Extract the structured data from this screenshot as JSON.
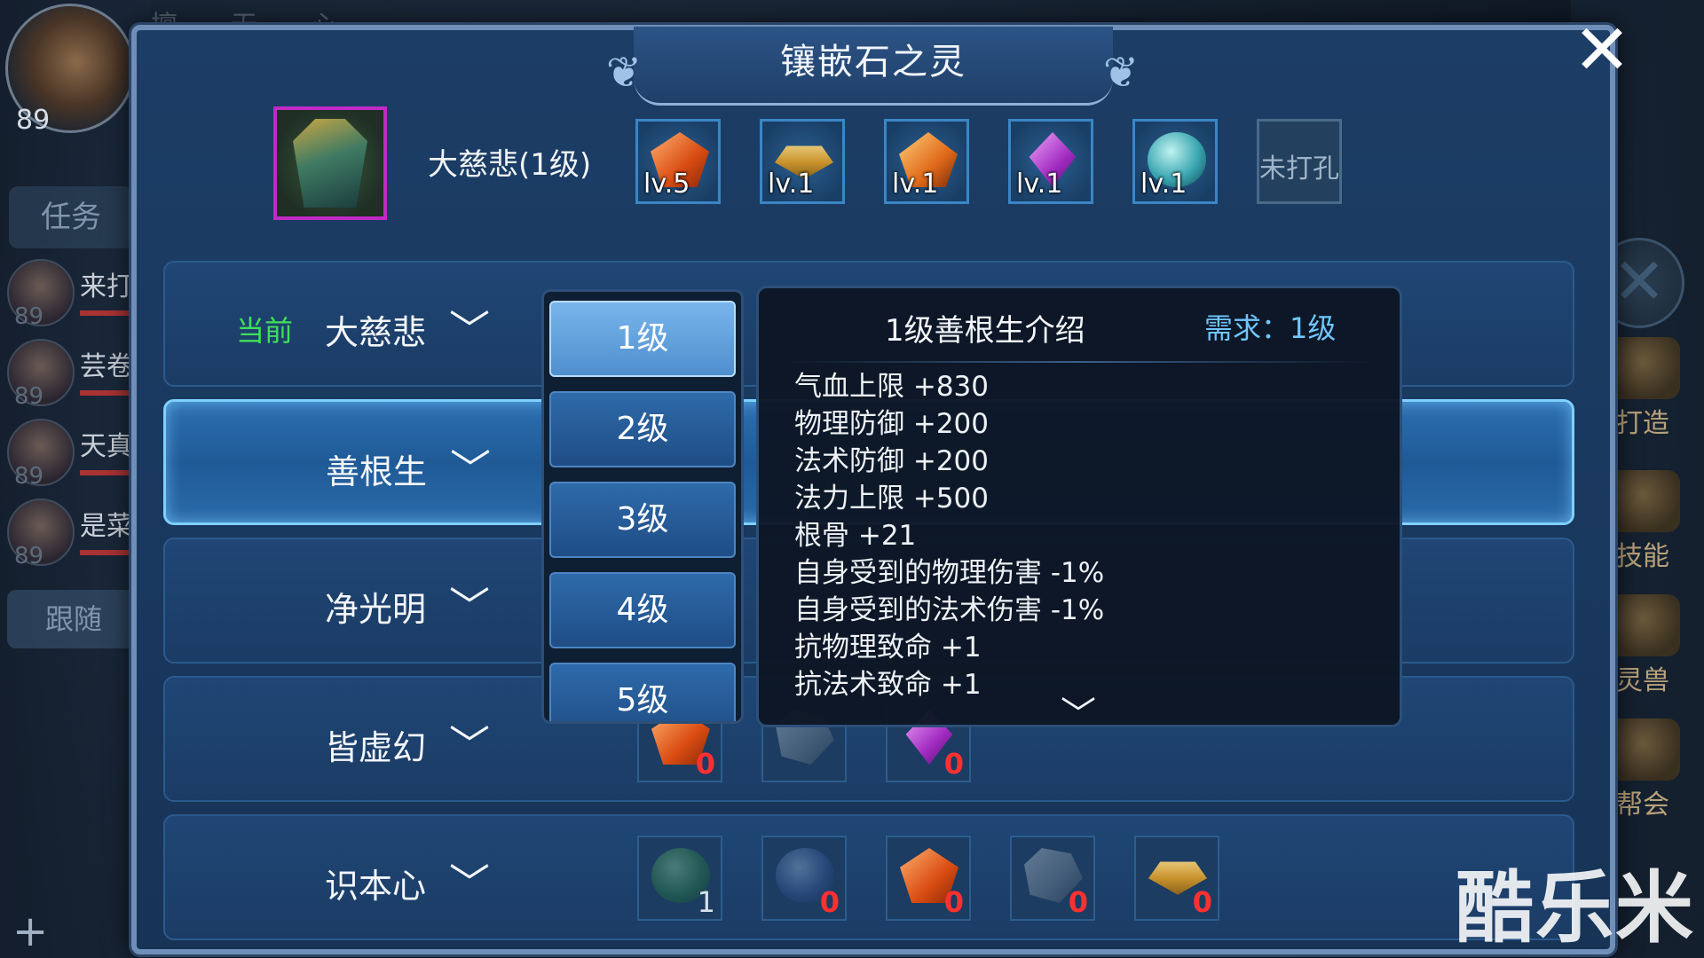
{
  "hud": {
    "top_faded_text": "擅……无……心",
    "player_level": "89",
    "task_label": "任务",
    "follow_label": "跟随",
    "team": [
      {
        "name": "来打",
        "level": "89"
      },
      {
        "name": "芸卷",
        "level": "89"
      },
      {
        "name": "天真",
        "level": "89"
      },
      {
        "name": "是菜",
        "level": "89"
      }
    ],
    "side_menu": [
      "打造",
      "技能",
      "灵兽",
      "帮会"
    ],
    "watermark": "酷乐米"
  },
  "modal": {
    "title": "镶嵌石之灵",
    "equipment": {
      "name": "大慈悲(1级)",
      "slots": [
        {
          "level": "lv.5",
          "stone": "s-orange"
        },
        {
          "level": "lv.1",
          "stone": "s-gold"
        },
        {
          "level": "lv.1",
          "stone": "s-amber"
        },
        {
          "level": "lv.1",
          "stone": "s-purple"
        },
        {
          "level": "lv.1",
          "stone": "s-teal"
        }
      ],
      "empty_slot": "未打孔"
    },
    "sets": [
      {
        "name": "大慈悲",
        "current_tag": "当前"
      },
      {
        "name": "善根生"
      },
      {
        "name": "净光明"
      },
      {
        "name": "皆虚幻"
      },
      {
        "name": "识本心"
      }
    ],
    "set_row4_gems": [
      {
        "count": "0",
        "stone": "s-orange"
      },
      {
        "count": "",
        "stone": "s-grey"
      },
      {
        "count": "0",
        "stone": "s-purple"
      }
    ],
    "set_row5_gems": [
      {
        "count": "1",
        "stone": "s-green"
      },
      {
        "count": "0",
        "stone": "s-blue"
      },
      {
        "count": "0",
        "stone": "s-orange"
      },
      {
        "count": "0",
        "stone": "s-grey"
      },
      {
        "count": "0",
        "stone": "s-gold"
      }
    ],
    "level_dropdown": [
      "1级",
      "2级",
      "3级",
      "4级",
      "5级"
    ],
    "tooltip": {
      "title": "1级善根生介绍",
      "requirement": "需求：1级",
      "stats": [
        "气血上限 +830",
        "物理防御 +200",
        "法术防御 +200",
        "法力上限 +500",
        "根骨 +21",
        "自身受到的物理伤害 -1%",
        "自身受到的法术伤害 -1%",
        "抗物理致命 +1",
        "抗法术致命 +1"
      ]
    }
  }
}
